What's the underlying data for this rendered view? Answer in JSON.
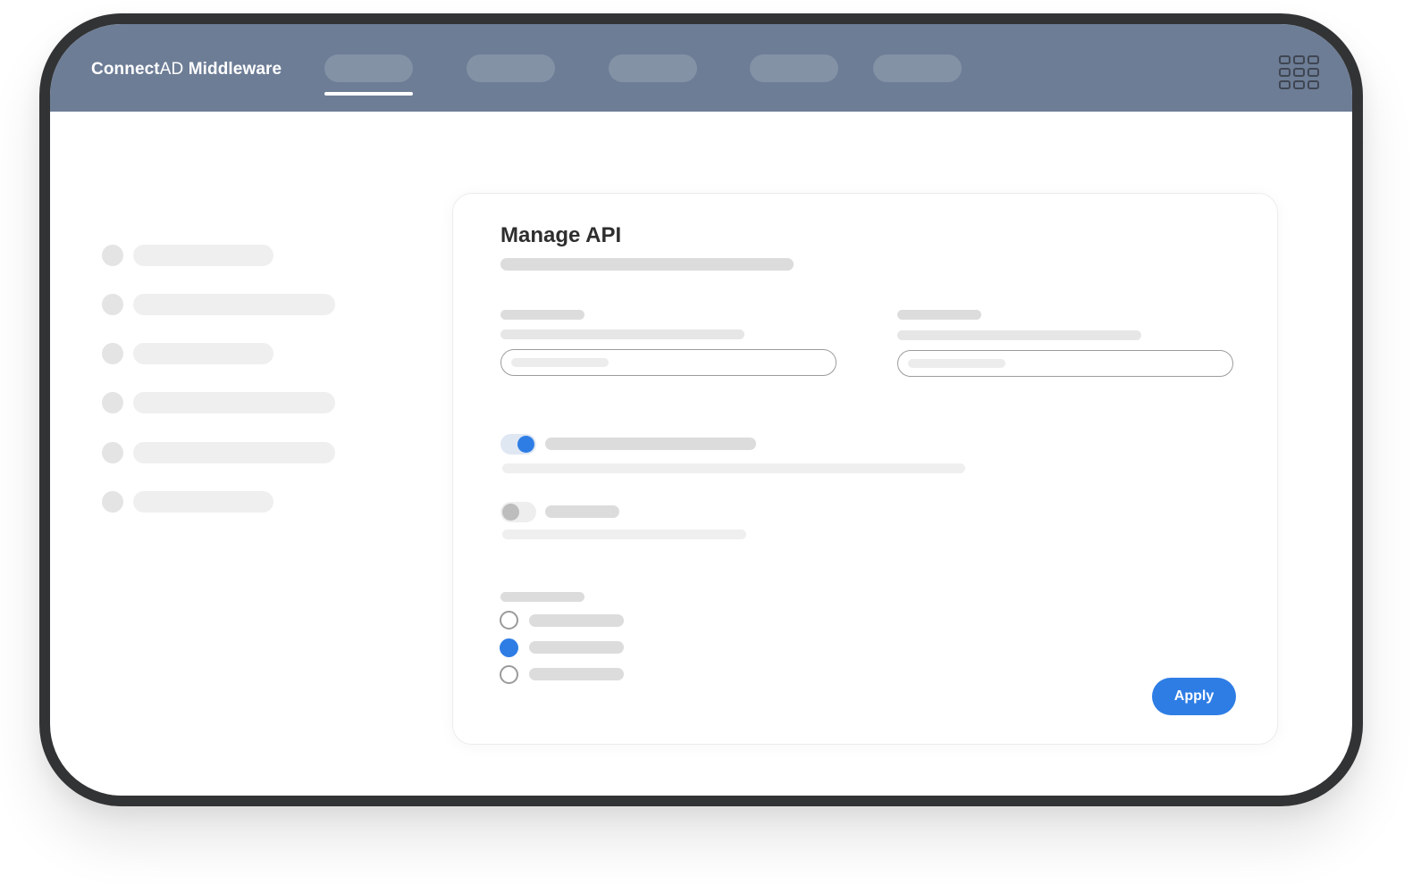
{
  "header": {
    "brand_bold": "Connect",
    "brand_light": "AD",
    "brand_rest": " Middleware",
    "apps_icon": "grid-icon",
    "active_nav_index": 0
  },
  "card": {
    "title": "Manage API",
    "api_toggle_1_on": true,
    "api_toggle_2_on": false,
    "selected_radio_index": 1,
    "apply_label": "Apply"
  },
  "colors": {
    "nav_bg": "#6d7d96",
    "accent": "#2e7de5",
    "frame": "#323335"
  }
}
